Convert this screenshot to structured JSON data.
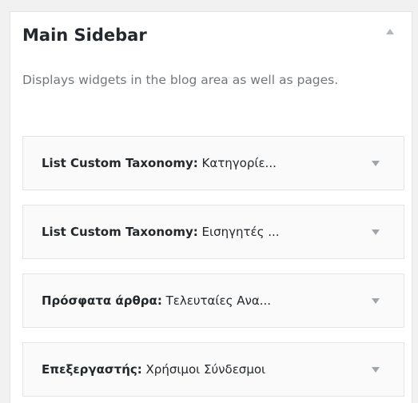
{
  "sidebar": {
    "title": "Main Sidebar",
    "description": "Displays widgets in the blog area as well as pages."
  },
  "widgets": [
    {
      "name": "List Custom Taxonomy",
      "separator": ":",
      "subtitle": " Κατηγορίε..."
    },
    {
      "name": "List Custom Taxonomy",
      "separator": ":",
      "subtitle": " Εισηγητές ..."
    },
    {
      "name": "Πρόσφατα άρθρα",
      "separator": ":",
      "subtitle": " Τελευταίες Ανα..."
    },
    {
      "name": "Επεξεργαστής",
      "separator": ":",
      "subtitle": " Χρήσιμοι Σύνδεσμοι"
    }
  ],
  "icons": {
    "collapse": "arrow-up-icon",
    "expand": "arrow-down-icon"
  },
  "colors": {
    "background": "#f1f1f1",
    "panel": "#ffffff",
    "widget_background": "#fafafa",
    "border": "#e5e5e5",
    "title_text": "#23282d",
    "description_text": "#72777c",
    "arrow": "#a0a5aa"
  }
}
